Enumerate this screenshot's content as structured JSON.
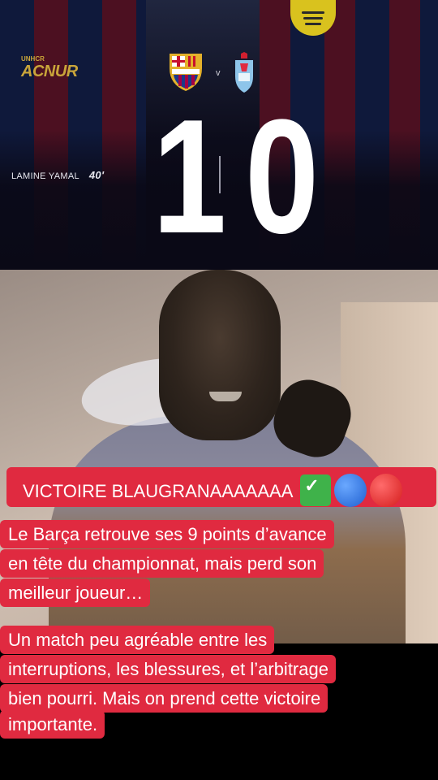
{
  "scoreboard": {
    "sponsor_name": "ACNUR",
    "sponsor_tag": "UNHCR",
    "vs_label": "v",
    "home_score": "1",
    "away_score": "0",
    "scorer_name": "LAMINE YAMAL",
    "scorer_minute": "40'",
    "colors": {
      "blaugrana_blue": "#1b2d6b",
      "blaugrana_red": "#8a1e3c",
      "score_text": "#ffffff"
    }
  },
  "captions": {
    "headline": "VICTOIRE BLAUGRANAAAAAAA",
    "headline_emojis": [
      "check-mark-icon",
      "blue-circle-icon",
      "red-circle-icon"
    ],
    "paragraph1": [
      "Le Barça retrouve ses 9 points d’avance",
      "en tête du championnat, mais perd son",
      "meilleur joueur…"
    ],
    "paragraph2": [
      "Un match peu agréable entre les",
      "interruptions, les blessures, et l’arbitrage",
      "bien pourri. Mais on prend cette victoire",
      "importante."
    ],
    "colors": {
      "bubble_bg": "#e02a40",
      "bubble_text": "#ffffff"
    }
  }
}
